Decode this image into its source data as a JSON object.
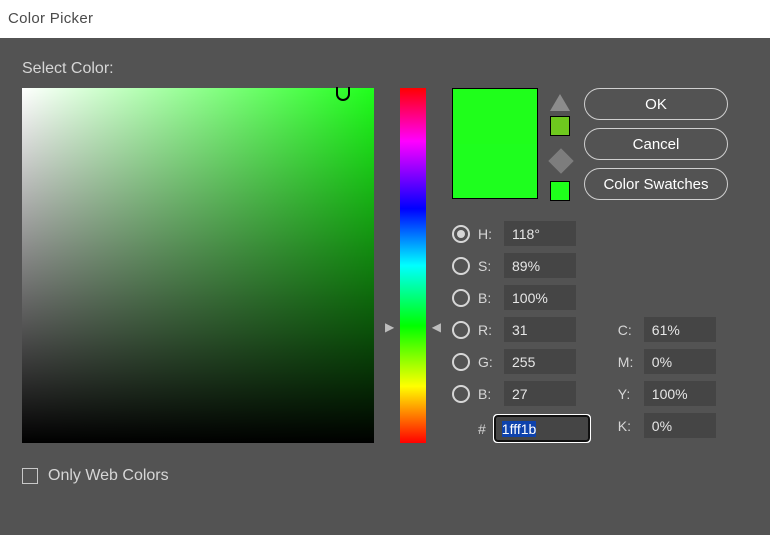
{
  "window": {
    "title": "Color Picker"
  },
  "panel": {
    "select_label": "Select Color:"
  },
  "buttons": {
    "ok": "OK",
    "cancel": "Cancel",
    "swatches": "Color Swatches"
  },
  "hsb": {
    "h": {
      "label": "H:",
      "value": "118°"
    },
    "s": {
      "label": "S:",
      "value": "89%"
    },
    "b": {
      "label": "B:",
      "value": "100%"
    }
  },
  "rgb": {
    "r": {
      "label": "R:",
      "value": "31"
    },
    "g": {
      "label": "G:",
      "value": "255"
    },
    "b": {
      "label": "B:",
      "value": "27"
    }
  },
  "cmyk": {
    "c": {
      "label": "C:",
      "value": "61%"
    },
    "m": {
      "label": "M:",
      "value": "0%"
    },
    "y": {
      "label": "Y:",
      "value": "100%"
    },
    "k": {
      "label": "K:",
      "value": "0%"
    }
  },
  "hex": {
    "label": "#",
    "value": "1fff1b"
  },
  "footer": {
    "web_colors": "Only Web Colors"
  },
  "colors": {
    "new_swatch": "#1fff1b",
    "current_swatch": "#1eff1e",
    "mini1": "#6ec81e",
    "mini2": "#1fff1b"
  }
}
